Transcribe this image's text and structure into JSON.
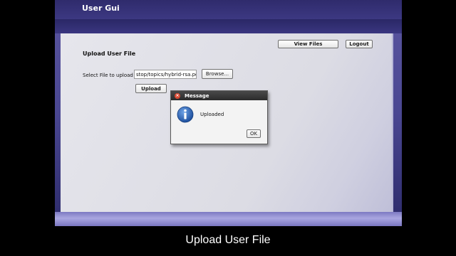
{
  "window": {
    "title": "User Gui"
  },
  "toolbar": {
    "view_files_label": "View Files",
    "logout_label": "Logout"
  },
  "upload": {
    "heading": "Upload User File",
    "select_label": "Select File to upload",
    "file_path": "stop/topics/hybrid-rsa.pdf",
    "browse_label": "Browse...",
    "upload_label": "Upload"
  },
  "dialog": {
    "title": "Message",
    "message": "Uploaded",
    "ok_label": "OK",
    "icon": "info-icon",
    "close_icon": "close-icon"
  },
  "caption": "Upload User File",
  "colors": {
    "titlebar": "#2f2b6c",
    "panel": "#e2e2e8",
    "dialog_title": "#2b2b2b",
    "info_icon": "#1d4f9e"
  }
}
